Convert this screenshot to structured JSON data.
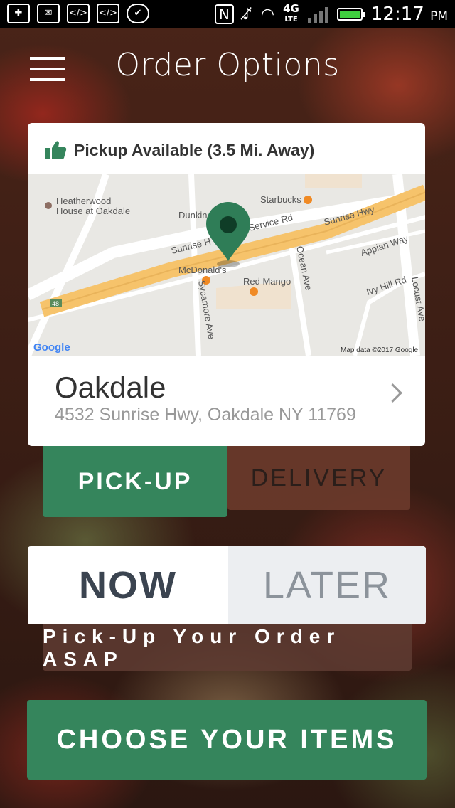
{
  "statusbar": {
    "time": "12:17",
    "ampm": "PM",
    "network": "4G",
    "network_sub": "LTE",
    "notification_icons": [
      "add-icon",
      "mail-icon",
      "code-icon",
      "code-icon",
      "check-icon"
    ]
  },
  "header": {
    "title": "Order Options"
  },
  "card": {
    "availability": "Pickup Available (3.5 Mi. Away)",
    "location_name": "Oakdale",
    "location_address": "4532 Sunrise Hwy, Oakdale NY 11769"
  },
  "map": {
    "labels": {
      "heatherwood1": "Heatherwood",
      "heatherwood2": "House at Oakdale",
      "starbucks": "Starbucks",
      "dunkin": "Dunkin",
      "service_rd": "Service Rd",
      "sunrise_hwy": "Sunrise Hwy",
      "sunrise_h": "Sunrise H",
      "appian": "Appian Way",
      "mcdonalds": "McDonald's",
      "ocean": "Ocean Ave",
      "red_mango": "Red Mango",
      "locust": "Locust Ave",
      "ivy_hill": "Ivy Hill Rd",
      "sycamore": "Sycamore Ave",
      "route": "48",
      "google": "Google",
      "map_data": "Map data ©2017 Google"
    }
  },
  "order_type": {
    "pickup_label": "PICK-UP",
    "delivery_label": "DELIVERY",
    "selected": "PICK-UP"
  },
  "timing": {
    "now_label": "NOW",
    "later_label": "LATER",
    "selected": "NOW",
    "message": "Pick-Up Your Order ASAP"
  },
  "cta": {
    "label": "CHOOSE YOUR ITEMS"
  },
  "colors": {
    "accent_green": "#35855c",
    "highway": "#f6c36b"
  }
}
